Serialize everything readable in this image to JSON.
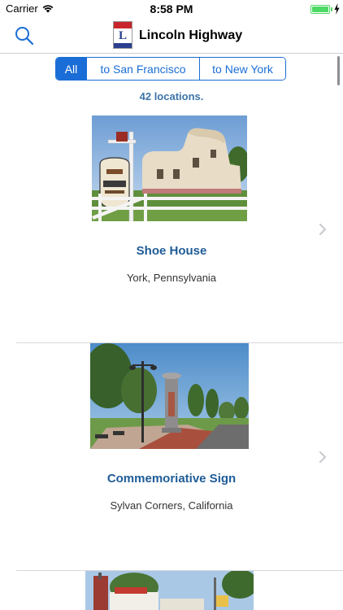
{
  "status_bar": {
    "carrier": "Carrier",
    "time": "8:58 PM",
    "battery_level": 1.0
  },
  "nav": {
    "title": "Lincoln Highway",
    "search_icon": "search-icon",
    "logo_letter": "L"
  },
  "filter": {
    "options": [
      "All",
      "to San Francisco",
      "to New York"
    ],
    "selected": "All"
  },
  "count_label": "42 locations.",
  "locations": [
    {
      "name": "Shoe House",
      "place": "York, Pennsylvania"
    },
    {
      "name": "Commemoriative Sign",
      "place": "Sylvan Corners, California"
    }
  ],
  "colors": {
    "accent": "#1a6dd6",
    "title": "#1f5c97",
    "count": "#3d74a8",
    "battery": "#4cd964"
  }
}
